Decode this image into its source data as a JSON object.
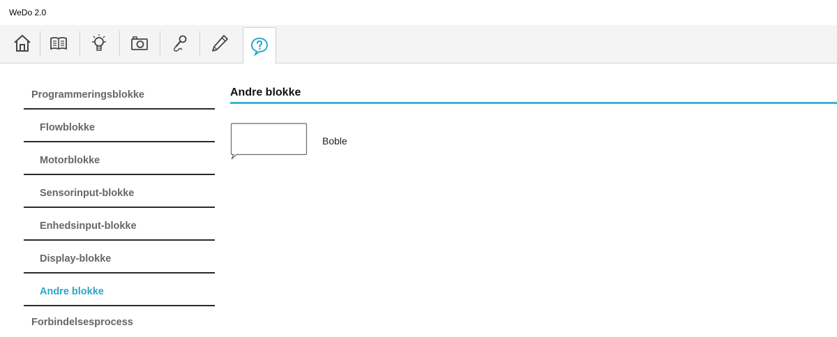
{
  "window": {
    "title": "WeDo 2.0"
  },
  "toolbar": {
    "buttons": [
      {
        "icon": "home-icon"
      },
      {
        "icon": "book-icon"
      },
      {
        "icon": "lightbulb-icon"
      },
      {
        "icon": "camera-icon"
      },
      {
        "icon": "microphone-icon"
      },
      {
        "icon": "pencil-icon"
      },
      {
        "icon": "help-icon",
        "active": true
      }
    ],
    "accent": "#2aa6c9"
  },
  "sidebar": {
    "items": [
      {
        "label": "Programmeringsblokke",
        "level": "top"
      },
      {
        "label": "Flowblokke",
        "level": "sub"
      },
      {
        "label": "Motorblokke",
        "level": "sub"
      },
      {
        "label": "Sensorinput-blokke",
        "level": "sub"
      },
      {
        "label": "Enhedsinput-blokke",
        "level": "sub"
      },
      {
        "label": "Display-blokke",
        "level": "sub"
      },
      {
        "label": "Andre blokke",
        "level": "sub",
        "active": true
      },
      {
        "label": "Forbindelsesprocess",
        "level": "top"
      }
    ]
  },
  "main": {
    "section_title": "Andre blokke",
    "rule_color": "#39b4d0",
    "blocks": [
      {
        "label": "Boble",
        "icon": "speech-bubble-icon"
      }
    ]
  }
}
